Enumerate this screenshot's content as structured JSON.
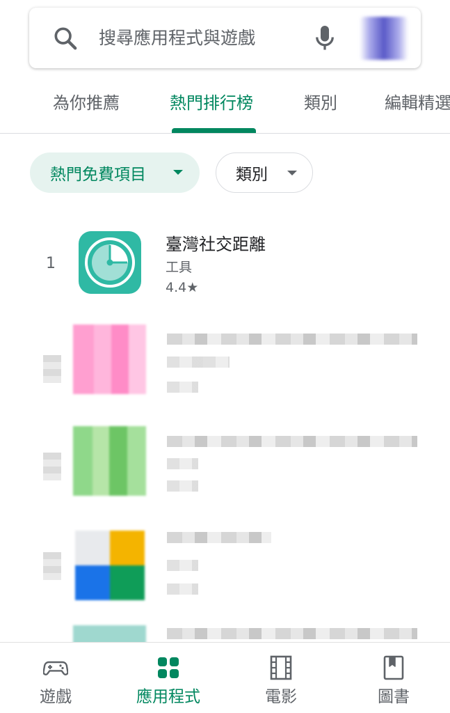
{
  "search": {
    "placeholder": "搜尋應用程式與遊戲"
  },
  "tabs": [
    {
      "label": "為你推薦"
    },
    {
      "label": "熱門排行榜"
    },
    {
      "label": "類別"
    },
    {
      "label": "編輯精選"
    }
  ],
  "chips": {
    "top_free": "熱門免費項目",
    "category": "類別"
  },
  "apps": [
    {
      "rank": "1",
      "name": "臺灣社交距離",
      "category": "工具",
      "rating": "4.4★"
    }
  ],
  "bottom_nav": [
    {
      "label": "遊戲"
    },
    {
      "label": "應用程式"
    },
    {
      "label": "電影"
    },
    {
      "label": "圖書"
    }
  ],
  "colors": {
    "accent": "#01875f",
    "chip_bg": "#e6f3ef",
    "app_icon": "#2fb9a4"
  }
}
